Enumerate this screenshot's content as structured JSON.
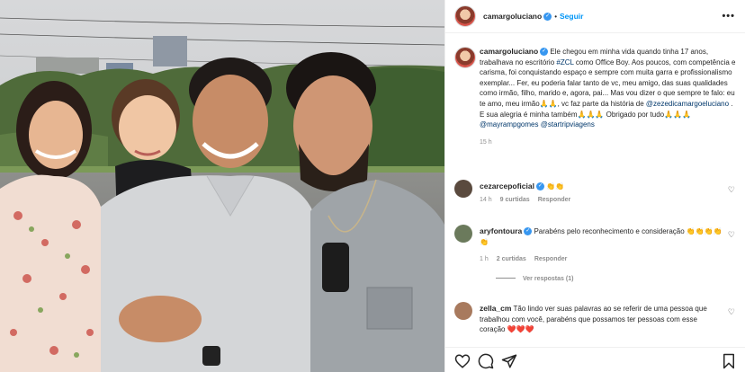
{
  "post": {
    "author": {
      "username": "camargoluciano",
      "verified_mark": "✓",
      "follow_label": "Seguir",
      "more_label": "•••"
    },
    "caption": {
      "username": "camargoluciano",
      "text_1": "Ele chegou em minha vida quando tinha 17 anos, trabalhava no escritório ",
      "hashtag": "#ZCL",
      "text_2": " como Office Boy. Aos poucos, com competência e carisma, foi conquistando espaço e sempre com muita garra e profissionalismo exemplar... Fer, eu poderia falar tanto de vc, meu amigo, das suas qualidades como irmão, filho, marido e, agora, pai... Mas vou dizer o que sempre te falo: eu te amo, meu irmão🙏🙏, vc faz parte da história de ",
      "mention_1": "@zezedicamargoeluciano",
      "text_3": " . E sua alegria é minha também🙏🙏🙏 Obrigado por tudo🙏🙏🙏 ",
      "mention_2": "@mayrampgomes",
      "mention_3": "@startripviagens",
      "time": "15 h"
    },
    "comments": [
      {
        "username": "cezarcepoficial",
        "verified": true,
        "text": "👏👏",
        "time": "14 h",
        "likes": "9 curtidas",
        "reply_label": "Responder",
        "avatar_color": "#5a4a3e"
      },
      {
        "username": "aryfontoura",
        "verified": true,
        "text": "Parabéns pelo reconhecimento e consideração 👏👏👏👏👏",
        "time": "1 h",
        "likes": "2 curtidas",
        "reply_label": "Responder",
        "replies_label": "Ver respostas (1)",
        "avatar_color": "#6b7a5c"
      },
      {
        "username": "zella_cm",
        "verified": false,
        "text": "Tão lindo ver suas palavras ao se referir de uma pessoa que trabalhou com você, parabéns que possamos ter pessoas com esse coração ❤️❤️❤️",
        "avatar_color": "#a87a5e"
      }
    ],
    "actions": {
      "like": "heart-icon",
      "comment": "comment-icon",
      "share": "share-icon",
      "save": "bookmark-icon"
    }
  }
}
